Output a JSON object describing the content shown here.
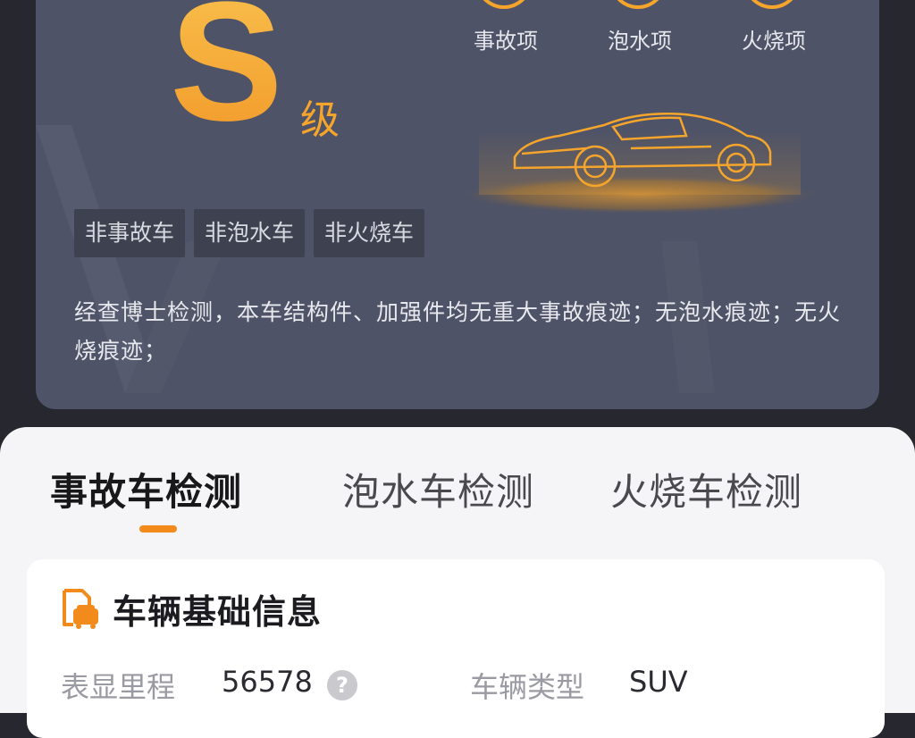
{
  "report": {
    "grade": "S",
    "grade_suffix": "级",
    "items": [
      {
        "label": "事故项"
      },
      {
        "label": "泡水项"
      },
      {
        "label": "火烧项"
      }
    ],
    "tags": [
      "非事故车",
      "非泡水车",
      "非火烧车"
    ],
    "summary": "经查博士检测，本车结构件、加强件均无重大事故痕迹；无泡水痕迹；无火烧痕迹；",
    "accent_color": "#f5a52c",
    "car_icon": "car-illustration"
  },
  "tabs": [
    {
      "label": "事故车检测",
      "active": true
    },
    {
      "label": "泡水车检测",
      "active": false
    },
    {
      "label": "火烧车检测",
      "active": false
    }
  ],
  "basic_info": {
    "title": "车辆基础信息",
    "icon": "car-document-icon",
    "fields": [
      {
        "label": "表显里程",
        "value": "56578"
      },
      {
        "label": "车辆类型",
        "value": "SUV"
      }
    ]
  }
}
